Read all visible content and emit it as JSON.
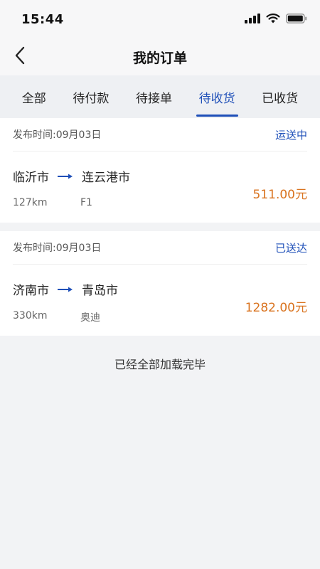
{
  "status_bar": {
    "time": "15:44"
  },
  "nav": {
    "title": "我的订单"
  },
  "tabs": [
    {
      "label": "全部"
    },
    {
      "label": "待付款"
    },
    {
      "label": "待接单"
    },
    {
      "label": "待收货"
    },
    {
      "label": "已收货"
    }
  ],
  "active_tab": "待收货",
  "orders": [
    {
      "publish_time": "发布时间:09月03日",
      "status": "运送中",
      "from": "临沂市",
      "to": "连云港市",
      "distance": "127km",
      "vehicle": "F1",
      "price": "511.00元"
    },
    {
      "publish_time": "发布时间:09月03日",
      "status": "已送达",
      "from": "济南市",
      "to": "青岛市",
      "distance": "330km",
      "vehicle": "奥迪",
      "price": "1282.00元"
    }
  ],
  "footer": {
    "loaded_all": "已经全部加载完毕"
  },
  "colors": {
    "accent": "#1e4fb8",
    "price": "#d9731f",
    "background": "#f2f3f5"
  },
  "icons": {
    "back": "chevron-left-icon",
    "route_arrow": "arrow-right-icon",
    "signal": "signal-icon",
    "wifi": "wifi-icon",
    "battery": "battery-icon"
  }
}
